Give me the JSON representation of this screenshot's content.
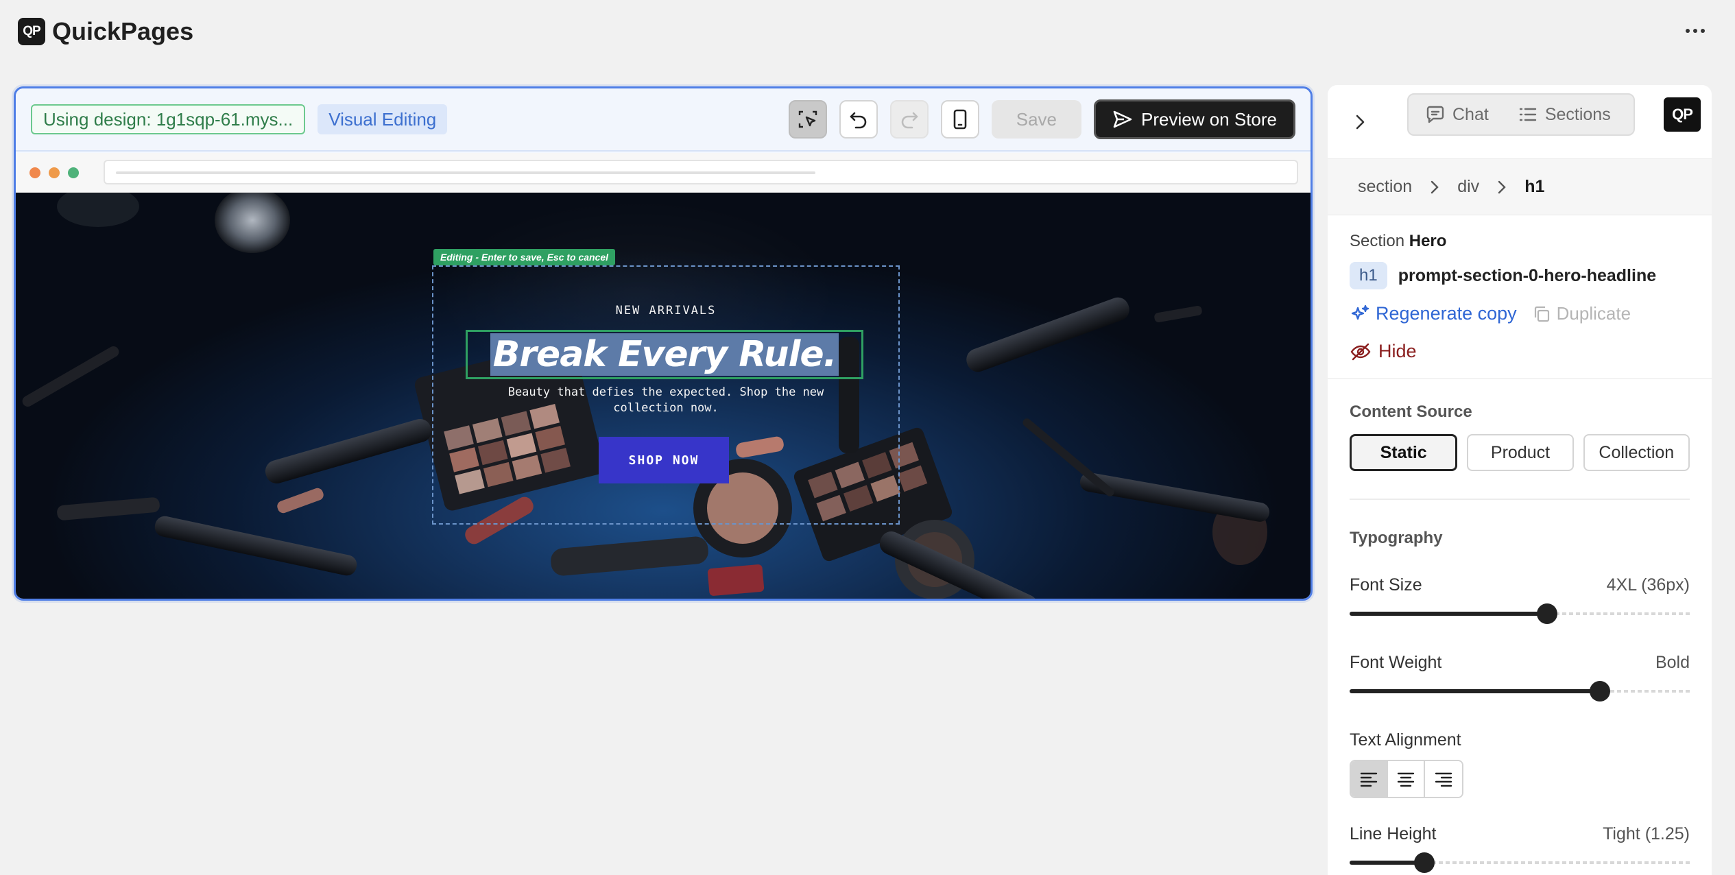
{
  "app": {
    "title": "QuickPages",
    "logo_text": "QP"
  },
  "toolbar": {
    "design_label": "Using design: 1g1sqp-61.mys...",
    "mode_label": "Visual Editing",
    "save_label": "Save",
    "preview_label": "Preview on Store"
  },
  "hero": {
    "editing_hint": "Editing - Enter to save, Esc to cancel",
    "eyebrow": "NEW ARRIVALS",
    "headline": "Break Every Rule.",
    "subtext": "Beauty that defies the expected. Shop the new collection now.",
    "cta": "SHOP NOW"
  },
  "panel": {
    "tabs": [
      {
        "label": "Chat",
        "icon": "chat-icon"
      },
      {
        "label": "Sections",
        "icon": "list-icon"
      }
    ],
    "logo_text": "QP",
    "breadcrumb": [
      "section",
      "div",
      "h1"
    ],
    "section_prefix": "Section",
    "section_name": "Hero",
    "element_tag": "h1",
    "element_id": "prompt-section-0-hero-headline",
    "regenerate_label": "Regenerate copy",
    "duplicate_label": "Duplicate",
    "hide_label": "Hide",
    "content_source": {
      "label": "Content Source",
      "options": [
        "Static",
        "Product",
        "Collection"
      ],
      "selected": "Static"
    },
    "typography": {
      "label": "Typography",
      "font_size": {
        "label": "Font Size",
        "value": "4XL (36px)",
        "level": 0.58
      },
      "font_weight": {
        "label": "Font Weight",
        "value": "Bold",
        "level": 0.735
      },
      "text_alignment": {
        "label": "Text Alignment",
        "options": [
          "left",
          "center",
          "right"
        ],
        "selected": "left"
      },
      "line_height": {
        "label": "Line Height",
        "value": "Tight (1.25)",
        "level": 0.22
      }
    }
  },
  "colors": {
    "accent_blue": "#4f7ee6",
    "cta": "#3735c9",
    "edit_green": "#2fa062",
    "hide_red": "#8a1e1e"
  }
}
